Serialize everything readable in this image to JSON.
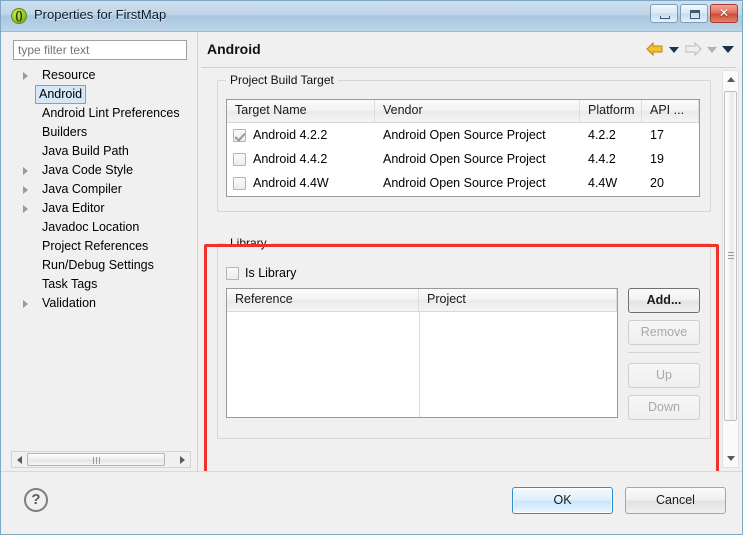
{
  "window": {
    "title": "Properties for FirstMap",
    "icon": "properties-icon",
    "minimize_label": "",
    "maximize_label": "",
    "close_label": "✕"
  },
  "sidebar": {
    "filter_placeholder": "type filter text",
    "filter_value": "",
    "items": [
      {
        "label": "Resource",
        "expandable": true,
        "selected": false
      },
      {
        "label": "Android",
        "expandable": false,
        "selected": true
      },
      {
        "label": "Android Lint Preferences",
        "expandable": false,
        "selected": false
      },
      {
        "label": "Builders",
        "expandable": false,
        "selected": false
      },
      {
        "label": "Java Build Path",
        "expandable": false,
        "selected": false
      },
      {
        "label": "Java Code Style",
        "expandable": true,
        "selected": false
      },
      {
        "label": "Java Compiler",
        "expandable": true,
        "selected": false
      },
      {
        "label": "Java Editor",
        "expandable": true,
        "selected": false
      },
      {
        "label": "Javadoc Location",
        "expandable": false,
        "selected": false
      },
      {
        "label": "Project References",
        "expandable": false,
        "selected": false
      },
      {
        "label": "Run/Debug Settings",
        "expandable": false,
        "selected": false
      },
      {
        "label": "Task Tags",
        "expandable": false,
        "selected": false
      },
      {
        "label": "Validation",
        "expandable": true,
        "selected": false
      }
    ]
  },
  "panel": {
    "title": "Android",
    "nav": {
      "back_icon": "back-arrow-icon",
      "back_dropdown_icon": "chevron-down-icon",
      "forward_icon": "forward-arrow-icon",
      "forward_dropdown_icon": "chevron-down-icon",
      "menu_icon": "chevron-down-icon"
    },
    "build_target": {
      "group_label": "Project Build Target",
      "columns": [
        "Target Name",
        "Vendor",
        "Platform",
        "API ..."
      ],
      "rows": [
        {
          "checked": true,
          "target_name": "Android 4.2.2",
          "vendor": "Android Open Source Project",
          "platform": "4.2.2",
          "api": "17"
        },
        {
          "checked": false,
          "target_name": "Android 4.4.2",
          "vendor": "Android Open Source Project",
          "platform": "4.4.2",
          "api": "19"
        },
        {
          "checked": false,
          "target_name": "Android 4.4W",
          "vendor": "Android Open Source Project",
          "platform": "4.4W",
          "api": "20"
        }
      ]
    },
    "library": {
      "group_label": "Library",
      "is_library_label": "Is Library",
      "is_library_checked": false,
      "columns": [
        "Reference",
        "Project"
      ],
      "rows": [],
      "buttons": [
        {
          "label": "Add...",
          "enabled": true
        },
        {
          "label": "Remove",
          "enabled": false
        },
        {
          "label": "Up",
          "enabled": false
        },
        {
          "label": "Down",
          "enabled": false
        }
      ]
    }
  },
  "footer": {
    "help_label": "?",
    "ok_label": "OK",
    "cancel_label": "Cancel"
  },
  "annotation": {
    "color": "#f0322a"
  }
}
